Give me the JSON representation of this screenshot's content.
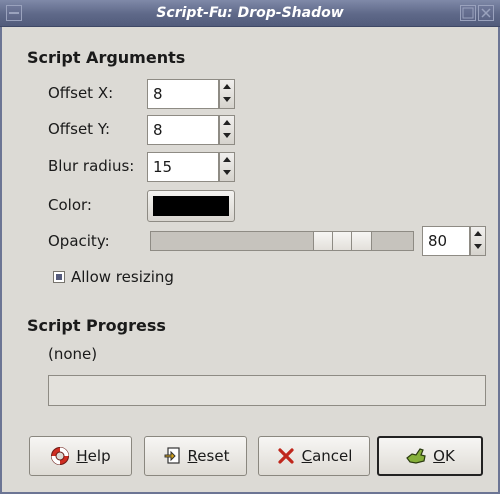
{
  "window": {
    "title": "Script-Fu: Drop-Shadow"
  },
  "arguments": {
    "heading": "Script Arguments",
    "offset_x": {
      "label": "Offset X:",
      "value": "8"
    },
    "offset_y": {
      "label": "Offset Y:",
      "value": "8"
    },
    "blur_radius": {
      "label": "Blur radius:",
      "value": "15"
    },
    "color": {
      "label": "Color:",
      "value": "#000000"
    },
    "opacity": {
      "label": "Opacity:",
      "value": "80",
      "level": 0.8
    },
    "allow_resizing": {
      "label": "Allow resizing",
      "checked": true
    }
  },
  "progress": {
    "heading": "Script Progress",
    "status": "(none)"
  },
  "buttons": {
    "help": {
      "mnemonic": "H",
      "rest": "elp"
    },
    "reset": {
      "mnemonic": "R",
      "rest": "eset"
    },
    "cancel": {
      "mnemonic": "C",
      "rest": "ancel"
    },
    "ok": {
      "mnemonic": "O",
      "rest": "K"
    }
  },
  "icons": {
    "help": "lifebuoy-icon",
    "reset": "reset-icon",
    "cancel": "cancel-x-icon",
    "ok": "ok-hand-icon"
  },
  "colors": {
    "titlebar": "#5e6888",
    "background": "#dcdad5"
  }
}
